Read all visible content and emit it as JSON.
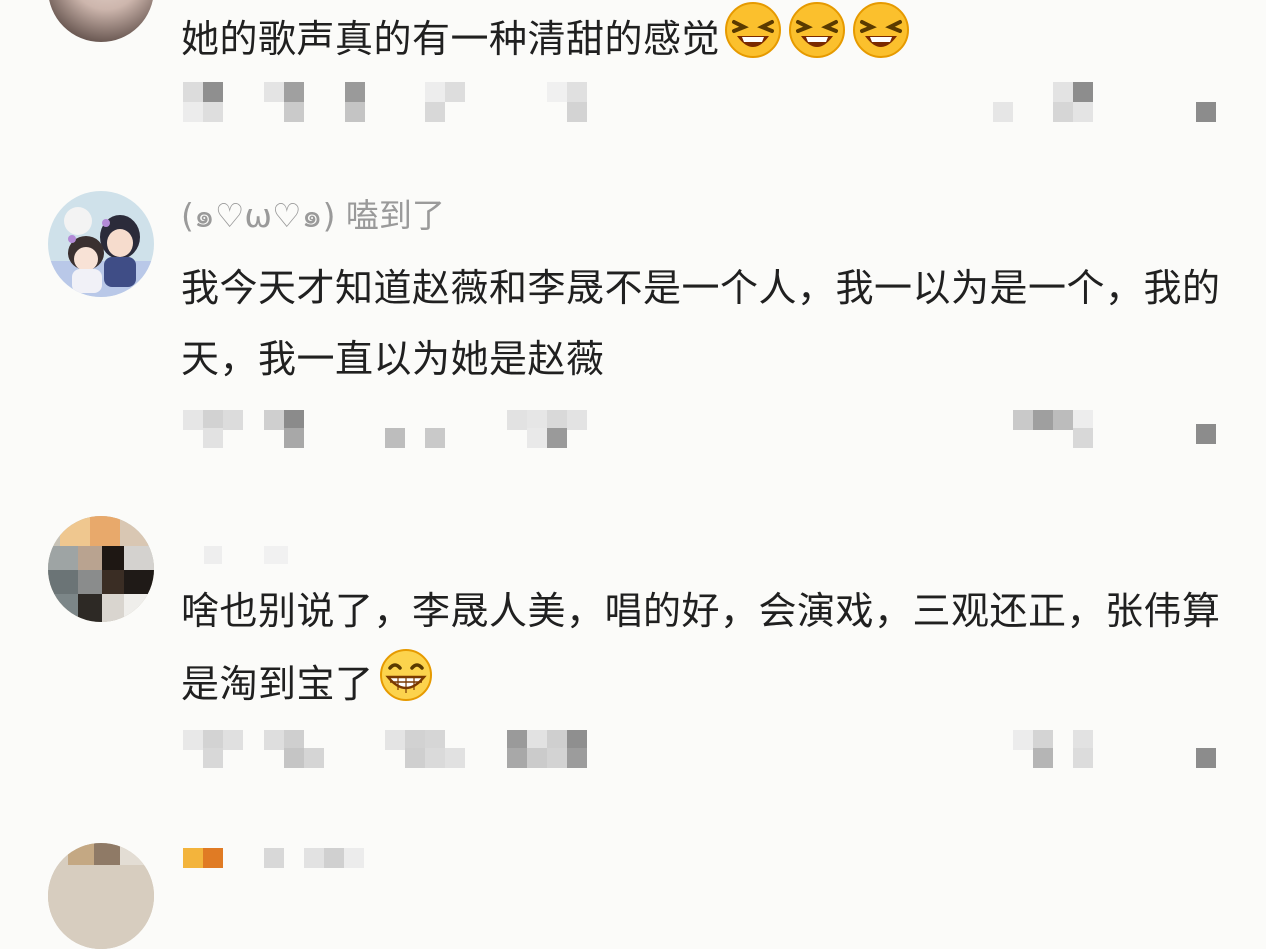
{
  "comments": [
    {
      "username": "",
      "text": "她的歌声真的有一种清甜的感觉",
      "emojis": [
        "laugh-squint-emoji",
        "laugh-squint-emoji",
        "laugh-squint-emoji"
      ]
    },
    {
      "username": "(๑♡ω♡๑) 嗑到了",
      "text": "我今天才知道赵薇和李晟不是一个人，我一以为是一个，我的天，我一直以为她是赵薇",
      "emojis": []
    },
    {
      "username": "",
      "text": "啥也别说了，李晟人美，唱的好，会演戏，三观还正，张伟算是淘到宝了",
      "emojis": [
        "grin-emoji"
      ]
    }
  ],
  "colors": {
    "background": "#fbfbf9",
    "text": "#202020",
    "username": "#9a9a9a",
    "mosaic_dark": "#8c8c8c",
    "mosaic_light": "#d9d9d9"
  }
}
